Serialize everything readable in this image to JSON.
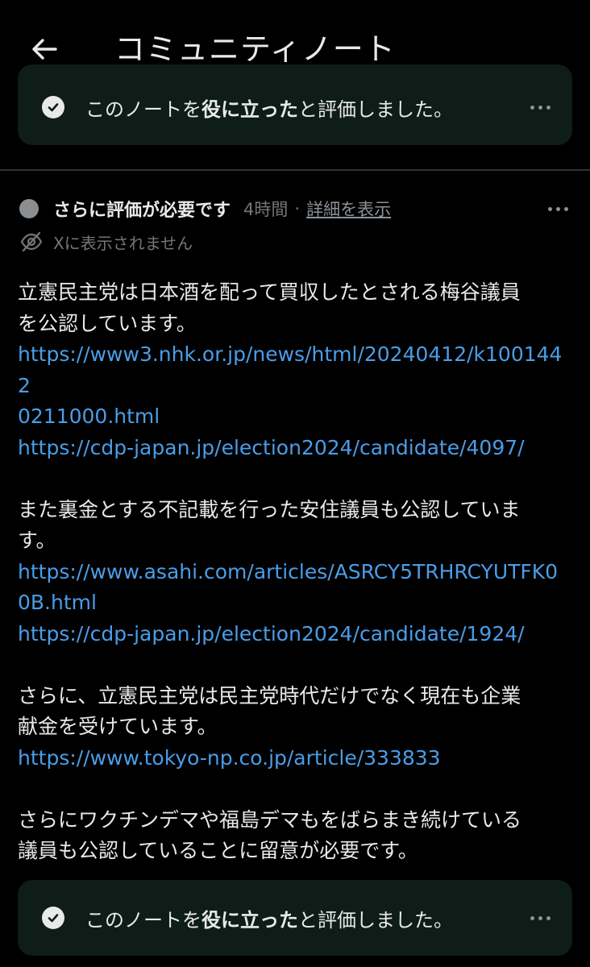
{
  "header": {
    "title": "コミュニティノート",
    "back_icon": "arrow-left-icon"
  },
  "rated_banner": {
    "prefix": "このノートを",
    "bold": "役に立った",
    "suffix": "と評価しました。",
    "icon": "check-circle-icon"
  },
  "status": {
    "label": "さらに評価が必要です",
    "time": "4時間",
    "separator": "·",
    "details_link": "詳細を表示",
    "hidden_text": "Xに表示されません",
    "hidden_icon": "eye-slash-icon"
  },
  "note": {
    "p1_line1": "立憲民主党は日本酒を配って買収したとされる梅谷議員",
    "p1_line2": "を公認しています。",
    "link1_line1": "https://www3.nhk.or.jp/news/html/20240412/k1001442",
    "link1_line2": "0211000.html",
    "link2": "https://cdp-japan.jp/election2024/candidate/4097/",
    "p2_line1": "また裏金とする不記載を行った安住議員も公認していま",
    "p2_line2": "す。",
    "link3_line1": "https://www.asahi.com/articles/ASRCY5TRHRCYUTFK0",
    "link3_line2": "0B.html",
    "link4": "https://cdp-japan.jp/election2024/candidate/1924/",
    "p3_line1": "さらに、立憲民主党は民主党時代だけでなく現在も企業",
    "p3_line2": "献金を受けています。",
    "link5": "https://www.tokyo-np.co.jp/article/333833",
    "p4_line1": "さらにワクチンデマや福島デマもをばらまき続けている",
    "p4_line2": "議員も公認していることに留意が必要です。"
  },
  "colors": {
    "background": "#000000",
    "text": "#e7e9ea",
    "muted": "#71767b",
    "link": "#4a9de8",
    "banner_bg": "#0e1d17",
    "divider": "#2f3336"
  }
}
